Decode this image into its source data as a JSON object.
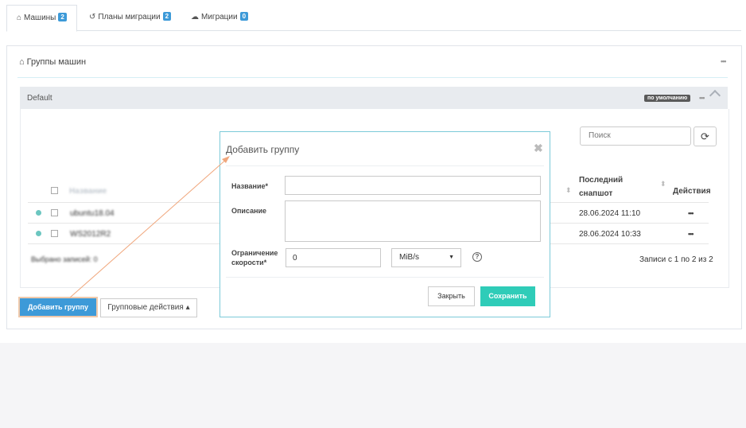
{
  "tabs": [
    {
      "label": "Машины",
      "count": "2",
      "icon": "home-icon"
    },
    {
      "label": "Планы миграции",
      "count": "2",
      "icon": "history-icon"
    },
    {
      "label": "Миграции",
      "count": "0",
      "icon": "cloud-icon"
    }
  ],
  "panel": {
    "title": "Группы машин",
    "icon": "home-icon"
  },
  "group": {
    "name": "Default",
    "badge": "по умолчанию"
  },
  "search": {
    "placeholder": "Поиск"
  },
  "table": {
    "col_name": "Название",
    "col_snapshot_line1": "Последний",
    "col_snapshot_line2": "снапшот",
    "col_actions": "Действия",
    "rows": [
      {
        "name": "ubuntu18.04",
        "snapshot": "28.06.2024 11:10"
      },
      {
        "name": "WS2012R2",
        "snapshot": "28.06.2024 10:33"
      }
    ],
    "selected_text": "Выбрано записей: 0",
    "records_text": "Записи с 1 по 2 из 2"
  },
  "buttons": {
    "add_group": "Добавить группу",
    "group_actions": "Групповые действия ▴"
  },
  "modal": {
    "title": "Добавить группу",
    "close_glyph": "✖",
    "name_label": "Название*",
    "name_value": "",
    "description_label": "Описание",
    "description_value": "",
    "speed_label_line1": "Ограничение",
    "speed_label_line2": "скорости*",
    "speed_value": "0",
    "unit_selected": "MiB/s",
    "help_glyph": "?",
    "close_button": "Закрыть",
    "save_button": "Сохранить"
  },
  "colors": {
    "accent": "#3d9ad8",
    "save": "#2fccb8",
    "annotation_arrow": "#f0a77d",
    "status": "#6cc6c0"
  }
}
